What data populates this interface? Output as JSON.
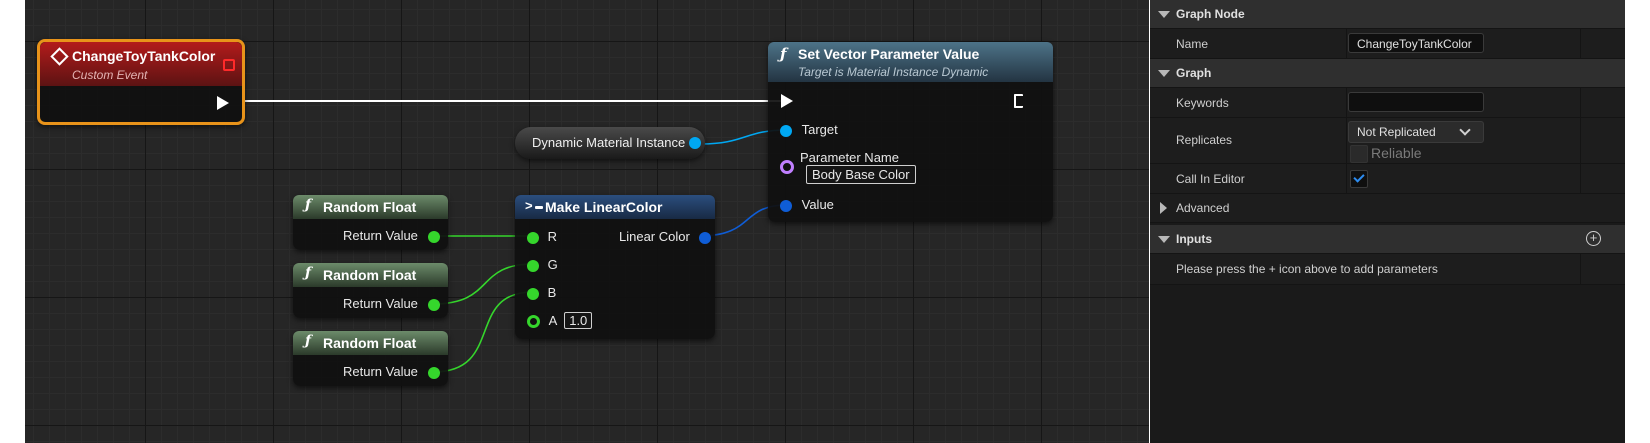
{
  "graph": {
    "event_node": {
      "title": "ChangeToyTankColor",
      "subtitle": "Custom Event"
    },
    "set_vector_node": {
      "title": "Set Vector Parameter Value",
      "subtitle": "Target is Material Instance Dynamic",
      "pins": {
        "target": "Target",
        "param_name": "Parameter Name",
        "param_value": "Body Base Color",
        "value": "Value"
      }
    },
    "dmi_node": {
      "label": "Dynamic Material Instance"
    },
    "random_nodes": [
      {
        "title": "Random Float",
        "output": "Return Value"
      },
      {
        "title": "Random Float",
        "output": "Return Value"
      },
      {
        "title": "Random Float",
        "output": "Return Value"
      }
    ],
    "make_color_node": {
      "title": "Make LinearColor",
      "pins": {
        "r": "R",
        "g": "G",
        "b": "B",
        "a": "A",
        "a_value": "1.0",
        "out": "Linear Color"
      }
    },
    "colors": {
      "exec": "#ffffff",
      "object": "#00a8f3",
      "name": "#c07fff",
      "float": "#35d62c",
      "struct": "#0f5dd6"
    }
  },
  "details": {
    "graph_node_section": "Graph Node",
    "name_label": "Name",
    "name_value": "ChangeToyTankColor",
    "graph_section": "Graph",
    "keywords_label": "Keywords",
    "keywords_value": "",
    "replicates_label": "Replicates",
    "replicates_value": "Not Replicated",
    "reliable_label": "Reliable",
    "reliable_checked": false,
    "call_in_editor_label": "Call In Editor",
    "call_in_editor_checked": true,
    "advanced_section": "Advanced",
    "inputs_section": "Inputs",
    "inputs_hint": "Please press the + icon above to add parameters"
  }
}
